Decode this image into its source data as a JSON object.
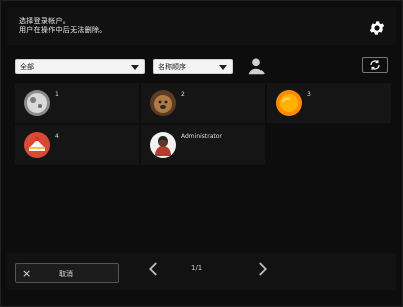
{
  "header": {
    "instruction_line1": "选择登录帐户。",
    "instruction_line2": "用户在操作中后无法删除。"
  },
  "controls": {
    "filter": {
      "selected": "全部"
    },
    "sort": {
      "selected": "名称顺序"
    }
  },
  "accounts": [
    {
      "label": "1"
    },
    {
      "label": "2"
    },
    {
      "label": "3"
    },
    {
      "label": "4"
    },
    {
      "label": "Administrator"
    }
  ],
  "footer": {
    "cancel_label": "取消",
    "pagination": "1/1"
  },
  "colors": {
    "background": "#0d0d0d",
    "tile": "#151515",
    "select_bg": "#f3f3f3"
  },
  "icons": {
    "settings": "gear-icon",
    "profile": "user-icon",
    "refresh": "refresh-icon",
    "prev": "chevron-left-icon",
    "next": "chevron-right-icon",
    "cancel": "close-icon"
  }
}
